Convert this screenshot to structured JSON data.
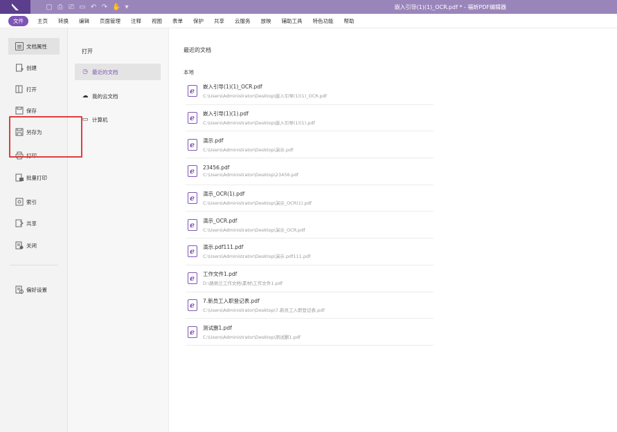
{
  "titlebar": {
    "title": "嵌入引导(1)(1)_OCR.pdf * - 福昕PDF编辑器",
    "quick_icons": [
      "new-icon",
      "save-icon",
      "print-icon",
      "copy-icon",
      "undo-icon",
      "redo-icon",
      "hand-icon",
      "more-icon"
    ]
  },
  "menubar": {
    "items": [
      "文件",
      "主页",
      "转换",
      "编辑",
      "页面管理",
      "注释",
      "视图",
      "表单",
      "保护",
      "共享",
      "云服务",
      "放映",
      "辅助工具",
      "特色功能",
      "帮助"
    ]
  },
  "leftnav": {
    "items": [
      {
        "label": "文档属性",
        "icon": "doc-properties-icon"
      },
      {
        "label": "创建",
        "icon": "create-icon"
      },
      {
        "label": "打开",
        "icon": "open-icon"
      },
      {
        "label": "保存",
        "icon": "save-icon"
      },
      {
        "label": "另存为",
        "icon": "save-as-icon"
      },
      {
        "label": "打印",
        "icon": "print-icon"
      },
      {
        "label": "批量打印",
        "icon": "batch-print-icon"
      },
      {
        "label": "索引",
        "icon": "index-icon"
      },
      {
        "label": "共享",
        "icon": "share-icon"
      },
      {
        "label": "关闭",
        "icon": "close-doc-icon"
      },
      {
        "label": "偏好设置",
        "icon": "preferences-icon"
      }
    ]
  },
  "midpane": {
    "heading": "打开",
    "items": [
      {
        "label": "最近的文档",
        "icon": "clock-icon"
      },
      {
        "label": "我的云文档",
        "icon": "cloud-icon"
      },
      {
        "label": "计算机",
        "icon": "computer-icon"
      }
    ]
  },
  "main": {
    "heading": "最近的文档",
    "section": "本地",
    "files": [
      {
        "name": "嵌入引导(1)(1)_OCR.pdf",
        "path": "C:\\Users\\Administrator\\Desktop\\嵌入引导(1)(1)_OCR.pdf"
      },
      {
        "name": "嵌入引导(1)(1).pdf",
        "path": "C:\\Users\\Administrator\\Desktop\\嵌入引导(1)(1).pdf"
      },
      {
        "name": "演示.pdf",
        "path": "C:\\Users\\Administrator\\Desktop\\演示.pdf"
      },
      {
        "name": "23456.pdf",
        "path": "C:\\Users\\Administrator\\Desktop\\23456.pdf"
      },
      {
        "name": "演示_OCR(1).pdf",
        "path": "C:\\Users\\Administrator\\Desktop\\演示_OCR(1).pdf"
      },
      {
        "name": "演示_OCR.pdf",
        "path": "C:\\Users\\Administrator\\Desktop\\演示_OCR.pdf"
      },
      {
        "name": "演示.pdf111.pdf",
        "path": "C:\\Users\\Administrator\\Desktop\\演示.pdf111.pdf"
      },
      {
        "name": "工作文件1.pdf",
        "path": "D:\\路佩兰工作文档\\素材\\工作文件1.pdf"
      },
      {
        "name": "7.新员工入职登记表.pdf",
        "path": "C:\\Users\\Administrator\\Desktop\\7.新员工入职登记表.pdf"
      },
      {
        "name": "测试删1.pdf",
        "path": "C:\\Users\\Administrator\\Desktop\\测试删1.pdf"
      }
    ]
  },
  "colors": {
    "titlebar": "#9a85bb",
    "accent": "#7d55b4",
    "highlight": "#e23b3b"
  }
}
